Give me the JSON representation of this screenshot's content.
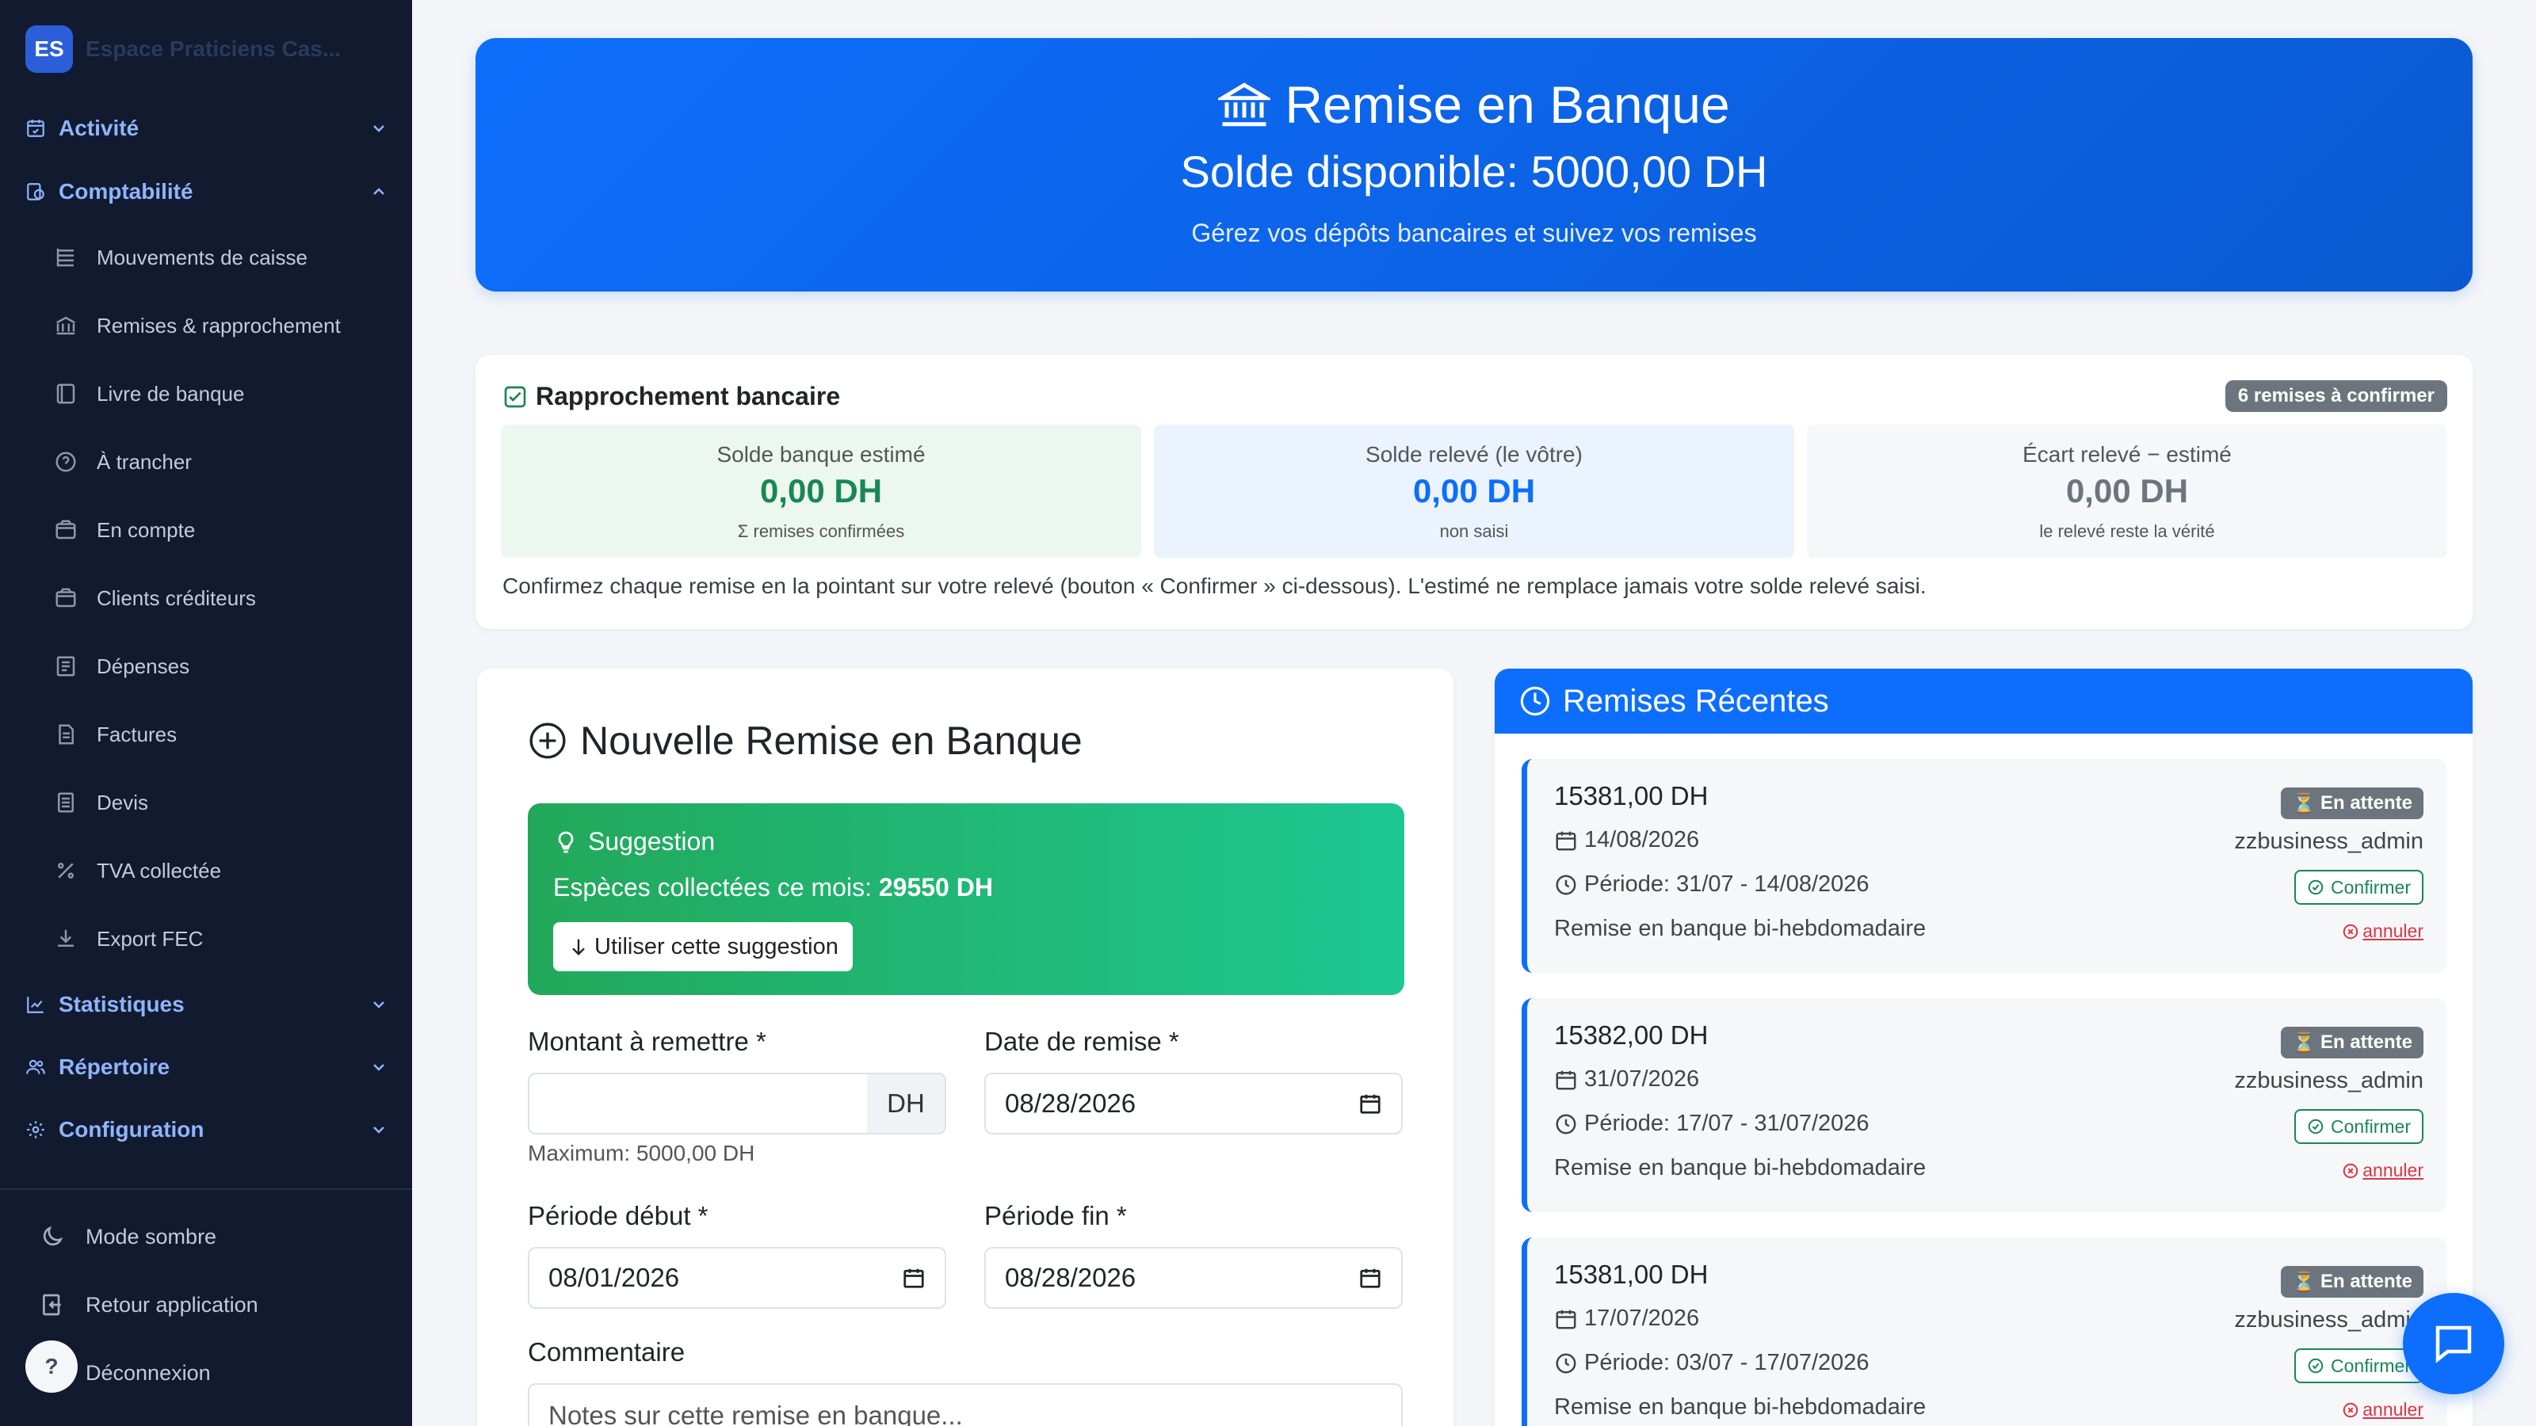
{
  "brand": {
    "logo": "ES",
    "name": "Espace Praticiens Cas..."
  },
  "sidebar": {
    "sections": {
      "activite": "Activité",
      "comptabilite": "Comptabilité",
      "statistiques": "Statistiques",
      "repertoire": "Répertoire",
      "configuration": "Configuration"
    },
    "items": [
      "Mouvements de caisse",
      "Remises & rapprochement",
      "Livre de banque",
      "À trancher",
      "En compte",
      "Clients créditeurs",
      "Dépenses",
      "Factures",
      "Devis",
      "TVA collectée",
      "Export FEC"
    ],
    "bottom": {
      "dark_mode": "Mode sombre",
      "back": "Retour application",
      "logout": "Déconnexion",
      "help": "?"
    }
  },
  "hero": {
    "title": "Remise en Banque",
    "balance": "Solde disponible: 5000,00 DH",
    "subtitle": "Gérez vos dépôts bancaires et suivez vos remises"
  },
  "rapprochement": {
    "title": "Rapprochement bancaire",
    "badge": "6 remises à confirmer",
    "stats": [
      {
        "label": "Solde banque estimé",
        "value": "0,00 DH",
        "sub": "Σ remises confirmées",
        "color": "#198754",
        "bg": "#ebf7ef"
      },
      {
        "label": "Solde relevé (le vôtre)",
        "value": "0,00 DH",
        "sub": "non saisi",
        "color": "#0d6efd",
        "bg": "#ebf3fe"
      },
      {
        "label": "Écart relevé − estimé",
        "value": "0,00 DH",
        "sub": "le relevé reste la vérité",
        "color": "#6c757d",
        "bg": "#f6f7f9"
      }
    ],
    "note": "Confirmez chaque remise en la pointant sur votre relevé (bouton « Confirmer » ci-dessous). L'estimé ne remplace jamais votre solde relevé saisi."
  },
  "form": {
    "title": "Nouvelle Remise en Banque",
    "suggestion": {
      "heading": "Suggestion",
      "text": "Espèces collectées ce mois:",
      "amount": "29550 DH",
      "button": "Utiliser cette suggestion"
    },
    "montant_label": "Montant à remettre *",
    "montant_value": "",
    "montant_addon": "DH",
    "montant_help": "Maximum: 5000,00 DH",
    "date_label": "Date de remise *",
    "date_value": "08/28/2026",
    "debut_label": "Période début *",
    "debut_value": "08/01/2026",
    "fin_label": "Période fin *",
    "fin_value": "08/28/2026",
    "comment_label": "Commentaire",
    "comment_placeholder": "Notes sur cette remise en banque..."
  },
  "recent": {
    "title": "Remises Récentes",
    "items": [
      {
        "amount": "15381,00 DH",
        "date": "14/08/2026",
        "period": "Période: 31/07 - 14/08/2026",
        "note": "Remise en banque bi-hebdomadaire",
        "status": "En attente",
        "user": "zzbusiness_admin",
        "confirm": "Confirmer",
        "cancel": "annuler"
      },
      {
        "amount": "15382,00 DH",
        "date": "31/07/2026",
        "period": "Période: 17/07 - 31/07/2026",
        "note": "Remise en banque bi-hebdomadaire",
        "status": "En attente",
        "user": "zzbusiness_admin",
        "confirm": "Confirmer",
        "cancel": "annuler"
      },
      {
        "amount": "15381,00 DH",
        "date": "17/07/2026",
        "period": "Période: 03/07 - 17/07/2026",
        "note": "Remise en banque bi-hebdomadaire",
        "status": "En attente",
        "user": "zzbusiness_admin",
        "confirm": "Confirmer",
        "cancel": "annuler"
      }
    ]
  },
  "colors": {
    "primary": "#0d6efd",
    "sidebar_bg": "#111a2e",
    "section_text": "#8fb4ff",
    "success": "#198754",
    "danger": "#dc3545"
  }
}
